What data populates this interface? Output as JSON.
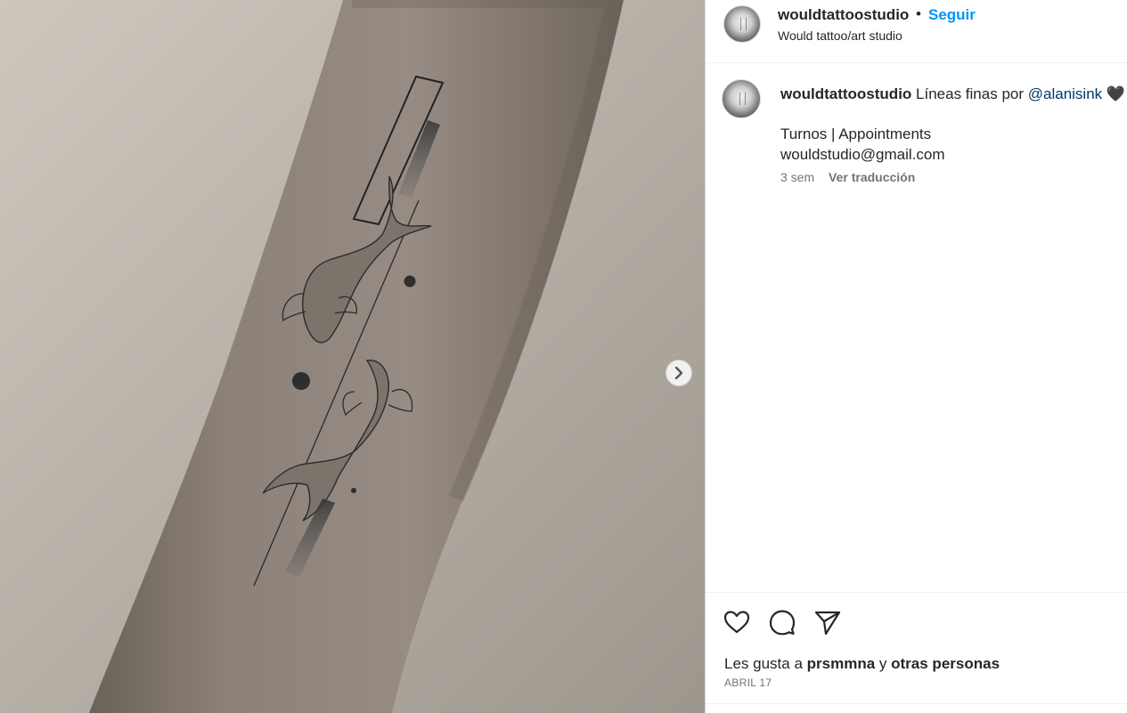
{
  "post": {
    "username": "wouldtattoostudio",
    "dot": "•",
    "follow_label": "Seguir",
    "subtitle": "Would tattoo/art studio"
  },
  "caption": {
    "username": "wouldtattoostudio",
    "text": "Líneas finas por",
    "mention": "@alanisink",
    "heart": "🖤",
    "line1": "Turnos | Appointments",
    "line2": "wouldstudio@gmail.com",
    "time": "3 sem",
    "translate": "Ver traducción"
  },
  "actions": {
    "icons": [
      "heart-icon",
      "comment-icon",
      "share-icon"
    ],
    "likes_prefix": "Les gusta a",
    "likes_user": "prsmmna",
    "likes_joiner": "y",
    "likes_others": "otras personas",
    "date": "ABRIL 17"
  },
  "media": {
    "description_icon": "chevron-right-icon"
  }
}
